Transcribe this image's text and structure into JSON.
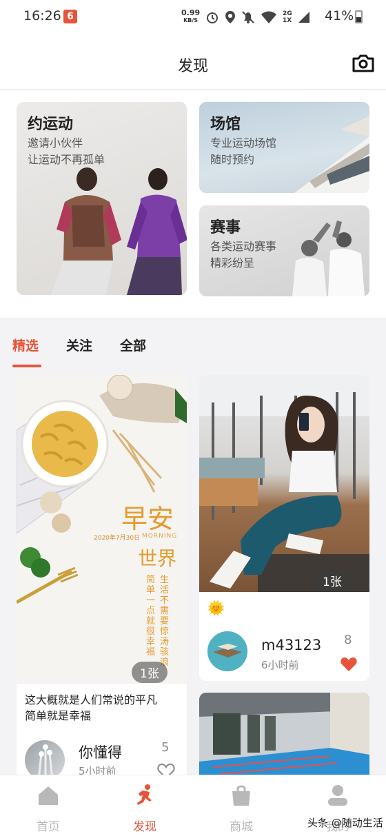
{
  "status_bar": {
    "time": "16:26",
    "app_badge": "6",
    "net_speed": "0.99",
    "net_speed_unit": "KB/S",
    "network_labels": [
      "2G",
      "1X"
    ],
    "battery": "41%"
  },
  "header": {
    "title": "发现",
    "camera_icon": "camera-icon"
  },
  "features": [
    {
      "title": "约运动",
      "subtitle_lines": [
        "邀请小伙伴",
        "让运动不再孤单"
      ]
    },
    {
      "title": "场馆",
      "subtitle_lines": [
        "专业运动场馆",
        "随时预约"
      ]
    },
    {
      "title": "赛事",
      "subtitle_lines": [
        "各类运动赛事",
        "精彩纷呈"
      ]
    }
  ],
  "tabs": [
    {
      "label": "精选",
      "active": true
    },
    {
      "label": "关注",
      "active": false
    },
    {
      "label": "全部",
      "active": false
    }
  ],
  "posts": [
    {
      "image_texts": {
        "headline": "早安",
        "date": "2020年7月30日",
        "morning": "MORNING",
        "world": "世界",
        "col_left": "简单一点就很幸福",
        "col_right": "生活不需要惊涛骇浪"
      },
      "count": "1张",
      "text_lines": [
        "这大概就是人们常说的平凡",
        "简单就是幸福"
      ],
      "user": "你懂得",
      "time": "5小时前",
      "likes": "5"
    },
    {
      "count": "1张",
      "emoji": "🌞",
      "user": "m43123",
      "time": "6小时前",
      "likes": "8"
    },
    {}
  ],
  "bottom_nav": [
    {
      "label": "首页",
      "icon": "home-icon",
      "active": false
    },
    {
      "label": "发现",
      "icon": "runner-icon",
      "active": true
    },
    {
      "label": "商城",
      "icon": "shopping-bag-icon",
      "active": false
    },
    {
      "label": "我的",
      "icon": "user-icon",
      "active": false
    }
  ],
  "watermark": "头条 @随动生活",
  "colors": {
    "accent": "#e8543a",
    "heart": "#e8543a"
  }
}
